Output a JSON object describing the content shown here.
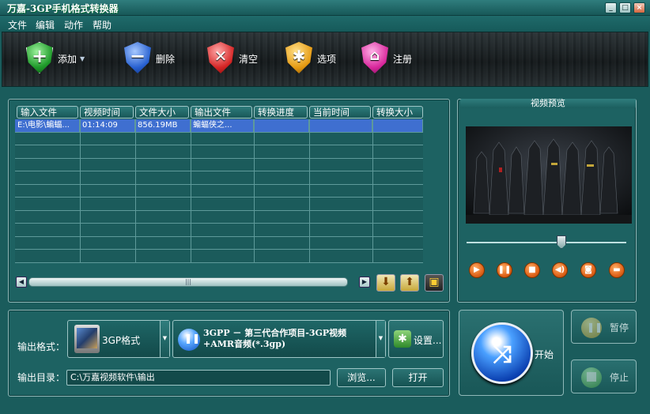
{
  "window": {
    "title": "万嘉-3GP手机格式转换器",
    "min": "_",
    "max": "□",
    "close": "×"
  },
  "menu": [
    "文件",
    "编辑",
    "动作",
    "帮助"
  ],
  "toolbar": {
    "add": "添加",
    "delete": "删除",
    "clear": "清空",
    "options": "选项",
    "register": "注册"
  },
  "table": {
    "columns": [
      "输入文件",
      "视频时间",
      "文件大小",
      "输出文件",
      "转换进度",
      "当前时间",
      "转换大小"
    ],
    "rows": [
      [
        "E:\\电影\\蝙蝠...",
        "01:14:09",
        "856.19MB",
        "蝙蝠侠之...",
        "",
        "",
        ""
      ]
    ]
  },
  "preview": {
    "title": "视频预览"
  },
  "output": {
    "format_label": "输出格式：",
    "format_value": "3GP格式",
    "profile_line1": "3GPP － 第三代合作项目-3GP视频",
    "profile_line2": "+AMR音频(*.3gp)",
    "settings_label": "设置...",
    "dir_label": "输出目录：",
    "dir_value": "C:\\万嘉视频软件\\输出",
    "browse_label": "浏览...",
    "open_label": "打开"
  },
  "actions": {
    "start": "开始",
    "pause": "暂停",
    "stop": "停止"
  }
}
